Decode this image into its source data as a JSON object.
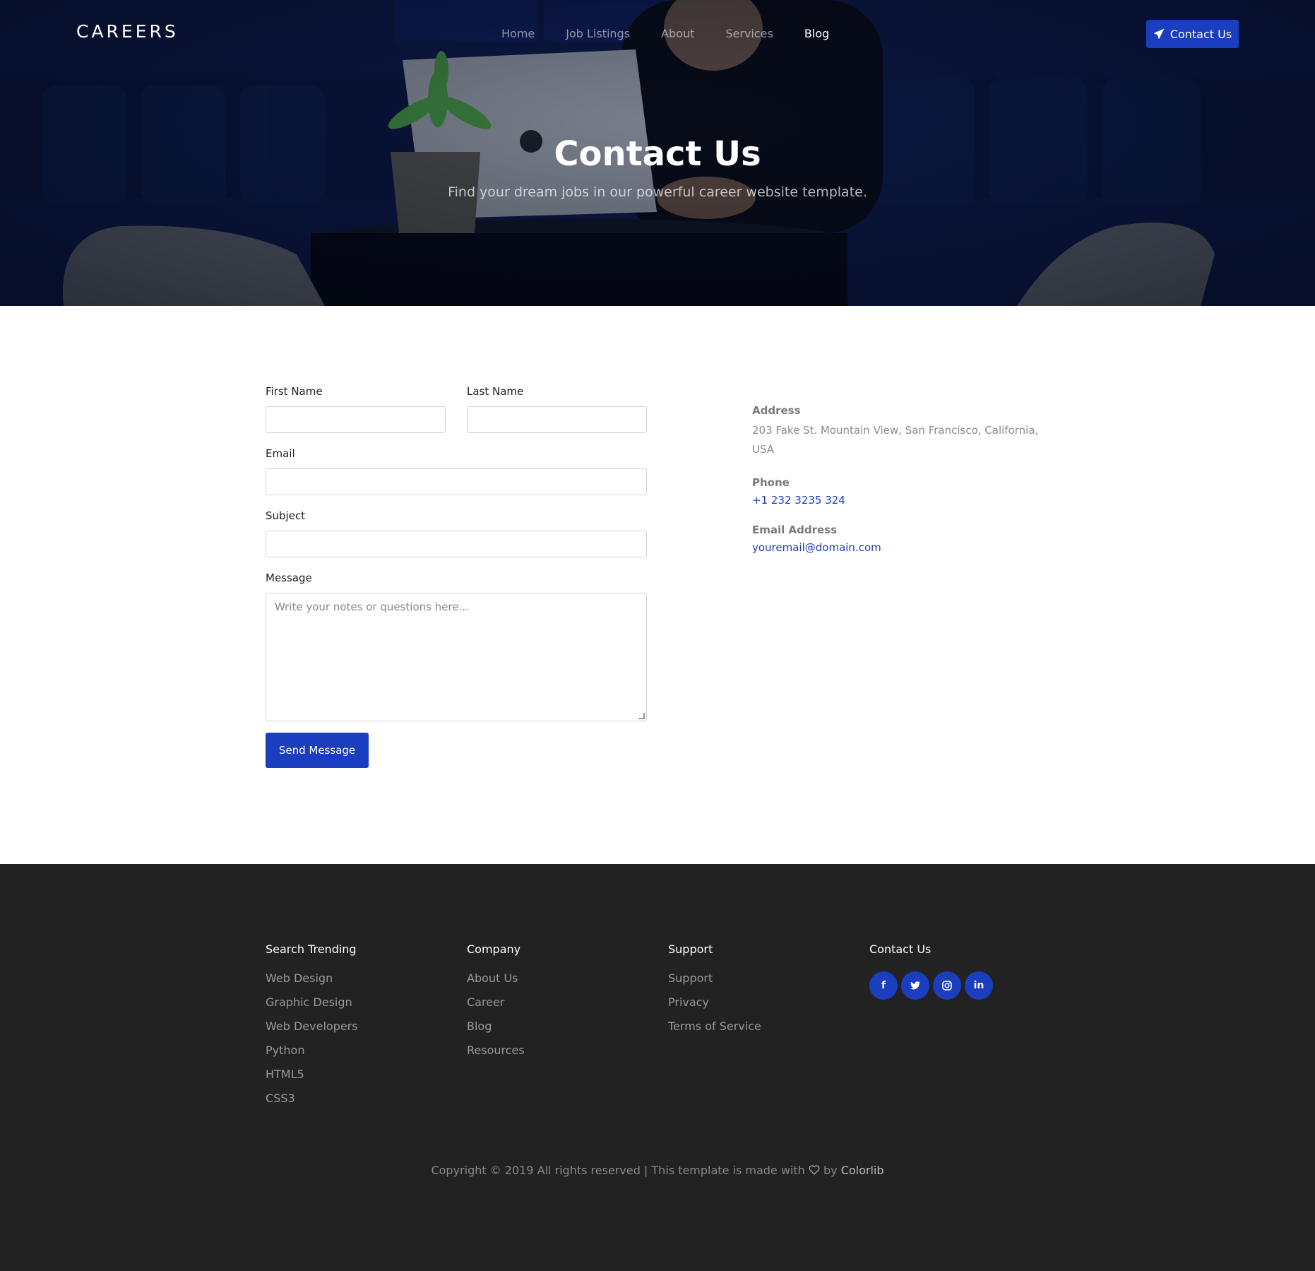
{
  "header": {
    "logo": "CAREERS",
    "nav": [
      "Home",
      "Job Listings",
      "About",
      "Services",
      "Blog"
    ],
    "active_nav": "Blog",
    "cta_label": "Contact Us"
  },
  "hero": {
    "title": "Contact Us",
    "subtitle": "Find your dream jobs in our powerful career website template."
  },
  "form": {
    "first_name_label": "First Name",
    "last_name_label": "Last Name",
    "email_label": "Email",
    "subject_label": "Subject",
    "message_label": "Message",
    "message_placeholder": "Write your notes or questions here...",
    "submit_label": "Send Message"
  },
  "contact_info": {
    "address_label": "Address",
    "address_value": "203 Fake St. Mountain View, San Francisco, California, USA",
    "phone_label": "Phone",
    "phone_value": "+1 232 3235 324",
    "email_label": "Email Address",
    "email_value": "youremail@domain.com"
  },
  "footer": {
    "columns": [
      {
        "title": "Search Trending",
        "items": [
          "Web Design",
          "Graphic Design",
          "Web Developers",
          "Python",
          "HTML5",
          "CSS3"
        ]
      },
      {
        "title": "Company",
        "items": [
          "About Us",
          "Career",
          "Blog",
          "Resources"
        ]
      },
      {
        "title": "Support",
        "items": [
          "Support",
          "Privacy",
          "Terms of Service"
        ]
      },
      {
        "title": "Contact Us",
        "items": []
      }
    ],
    "socials": [
      "facebook-icon",
      "twitter-icon",
      "instagram-icon",
      "linkedin-icon"
    ],
    "copyright_prefix": "Copyright © 2019 All rights reserved | This template is made with",
    "copyright_by": "by",
    "copyright_brand": "Colorlib"
  },
  "colors": {
    "accent": "#1a3ebf",
    "footer_bg": "#222222"
  }
}
